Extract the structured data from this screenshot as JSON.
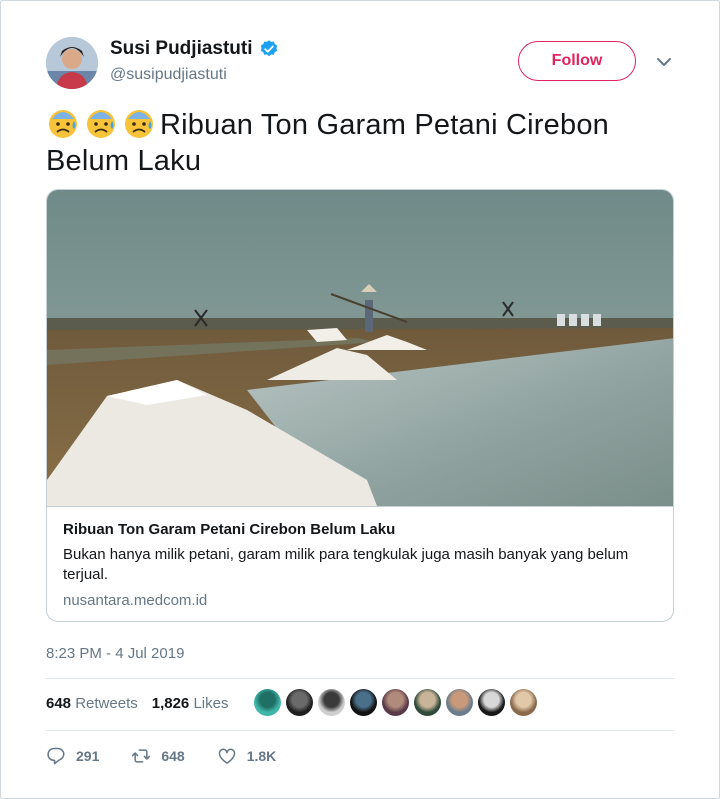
{
  "author": {
    "name": "Susi Pudjiastuti",
    "handle": "@susipudjiastuti",
    "avatar_icon": "profile-photo-avatar",
    "verified_icon": "verified-badge-icon"
  },
  "follow_label": "Follow",
  "tweet": {
    "emojis": [
      "😰",
      "😰",
      "😰"
    ],
    "text": "Ribuan Ton Garam Petani Cirebon Belum Laku"
  },
  "card": {
    "title": "Ribuan Ton Garam Petani Cirebon Belum Laku",
    "description": "Bukan hanya milik petani, garam milik para tengkulak juga masih banyak yang belum terjual.",
    "domain": "nusantara.medcom.id"
  },
  "timestamp": "8:23 PM - 4 Jul 2019",
  "stats": {
    "retweets_count": "648",
    "retweets_label": "Retweets",
    "likes_count": "1,826",
    "likes_label": "Likes"
  },
  "likers_count": 9,
  "actions": {
    "reply_count": "291",
    "retweet_count": "648",
    "like_count": "1.8K"
  },
  "colors": {
    "follow_accent": "#e0245e",
    "verified": "#1da1f2",
    "secondary_text": "#657786"
  }
}
